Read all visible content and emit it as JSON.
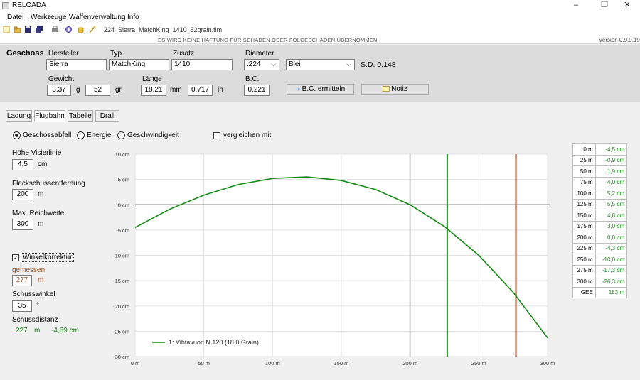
{
  "window": {
    "title": "RELOADA",
    "controls": [
      "–",
      "❐",
      "✕"
    ]
  },
  "menu": [
    "Datei",
    "Werkzeuge",
    "Waffenverwaltung",
    "Info"
  ],
  "toolbar": {
    "file_name": "224_Sierra_MatchKing_1410_52grain.tlm",
    "icons": [
      "new-file-icon",
      "open-icon",
      "save-icon",
      "save-all-icon",
      "print-icon",
      "settings-icon",
      "hand-icon",
      "wand-icon"
    ]
  },
  "disclaimer": "ES WIRD KEINE HAFTUNG FÜR SCHÄDEN ODER FOLGESCHÄDEN ÜBERNOMMEN",
  "version": "Version 0.9.9.19",
  "projectile": {
    "section_label": "Geschoss",
    "manufacturer_label": "Hersteller",
    "manufacturer": "Sierra",
    "type_label": "Typ",
    "type": "MatchKing",
    "extra_label": "Zusatz",
    "extra": "1410",
    "diameter_label": "Diameter",
    "diameter": ".224",
    "material": "Blei",
    "sd": "S.D. 0,148",
    "weight_label": "Gewicht",
    "weight_g": "3,37",
    "weight_g_unit": "g",
    "weight_gr": "52",
    "weight_gr_unit": "gr",
    "length_label": "Länge",
    "length_mm": "18,21",
    "length_mm_unit": "mm",
    "length_in": "0,717",
    "length_in_unit": "in",
    "bc_label": "B.C.",
    "bc": "0,221",
    "bc_button": "B.C. ermitteln",
    "note_button": "Notiz"
  },
  "tabs": [
    "Ladung",
    "Flugbahn",
    "Tabelle",
    "Drall"
  ],
  "active_tab": "Flugbahn",
  "view_options": {
    "opt_drop": "Geschossabfall",
    "opt_energy": "Energie",
    "opt_velocity": "Geschwindigkeit",
    "compare": "vergleichen mit"
  },
  "params": {
    "sight_height_label": "Höhe Visierlinie",
    "sight_height": "4,5",
    "sight_height_unit": "cm",
    "zero_label": "Fleckschussentfernung",
    "zero": "200",
    "zero_unit": "m",
    "max_range_label": "Max. Reichweite",
    "max_range": "300",
    "max_range_unit": "m",
    "angle_correction_label": "Winkelkorrektur",
    "measured_label": "gemessen",
    "measured": "277",
    "measured_unit": "m",
    "shot_angle_label": "Schusswinkel",
    "shot_angle": "35",
    "shot_angle_unit": "°",
    "shot_distance_label": "Schussdistanz",
    "shot_distance_m": "227",
    "shot_distance_unit": "m",
    "shot_distance_drop": "-4,69 cm"
  },
  "colors": {
    "curve": "#148a14",
    "marker_green": "#148a14",
    "marker_brown": "#a0421c",
    "marker_gray": "#c8c8c8"
  },
  "chart_data": {
    "type": "line",
    "xlabel": "",
    "ylabel": "",
    "xlim": [
      0,
      300
    ],
    "ylim": [
      -30,
      10
    ],
    "x_ticks": [
      "0 m",
      "50 m",
      "100 m",
      "150 m",
      "200 m",
      "250 m",
      "300 m"
    ],
    "y_ticks": [
      "10 cm",
      "5 cm",
      "0 cm",
      "-5 cm",
      "-10 cm",
      "-15 cm",
      "-20 cm",
      "-25 cm",
      "-30 cm"
    ],
    "grid": true,
    "legend_position": "bottom-left",
    "series": [
      {
        "name": "1: Vihtavuori N 120 (18,0 Grain)",
        "x": [
          0,
          25,
          50,
          75,
          100,
          125,
          150,
          175,
          200,
          225,
          250,
          275,
          300
        ],
        "y": [
          -4.5,
          -0.9,
          1.9,
          4.0,
          5.2,
          5.5,
          4.8,
          3.0,
          0.0,
          -4.3,
          -10.0,
          -17.3,
          -26.3
        ]
      }
    ],
    "markers_x": [
      200,
      227,
      277
    ]
  },
  "range_table": {
    "rows": [
      {
        "d": "0 m",
        "v": "-4,5 cm"
      },
      {
        "d": "25 m",
        "v": "-0,9 cm"
      },
      {
        "d": "50 m",
        "v": "1,9 cm"
      },
      {
        "d": "75 m",
        "v": "4,0 cm"
      },
      {
        "d": "100 m",
        "v": "5,2 cm"
      },
      {
        "d": "125 m",
        "v": "5,5 cm"
      },
      {
        "d": "150 m",
        "v": "4,8 cm"
      },
      {
        "d": "175 m",
        "v": "3,0 cm"
      },
      {
        "d": "200 m",
        "v": "0,0 cm"
      },
      {
        "d": "225 m",
        "v": "-4,3 cm"
      },
      {
        "d": "250 m",
        "v": "-10,0 cm"
      },
      {
        "d": "275 m",
        "v": "-17,3 cm"
      },
      {
        "d": "300 m",
        "v": "-26,3 cm"
      },
      {
        "d": "GEE",
        "v": "183 m"
      }
    ]
  }
}
